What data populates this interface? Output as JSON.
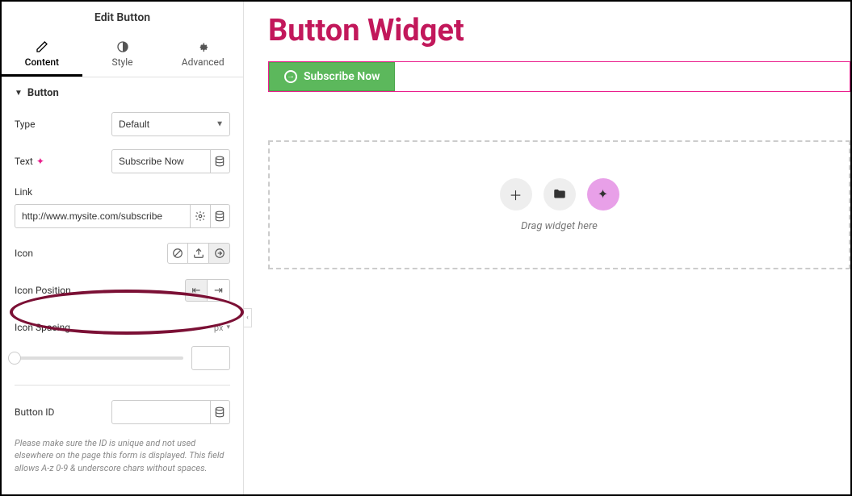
{
  "sidebar": {
    "title": "Edit Button",
    "tabs": {
      "content": "Content",
      "style": "Style",
      "advanced": "Advanced"
    },
    "section": {
      "title": "Button"
    },
    "fields": {
      "type_label": "Type",
      "type_value": "Default",
      "text_label": "Text",
      "text_value": "Subscribe Now",
      "link_label": "Link",
      "link_value": "http://www.mysite.com/subscribe",
      "icon_label": "Icon",
      "icon_position_label": "Icon Position",
      "icon_spacing_label": "Icon Spacing",
      "icon_spacing_unit": "px",
      "button_id_label": "Button ID",
      "button_id_value": "",
      "help_text": "Please make sure the ID is unique and not used elsewhere on the page this form is displayed. This field allows A-z 0-9 & underscore chars without spaces."
    }
  },
  "canvas": {
    "page_title": "Button Widget",
    "button_text": "Subscribe Now",
    "drop_text": "Drag widget here"
  }
}
